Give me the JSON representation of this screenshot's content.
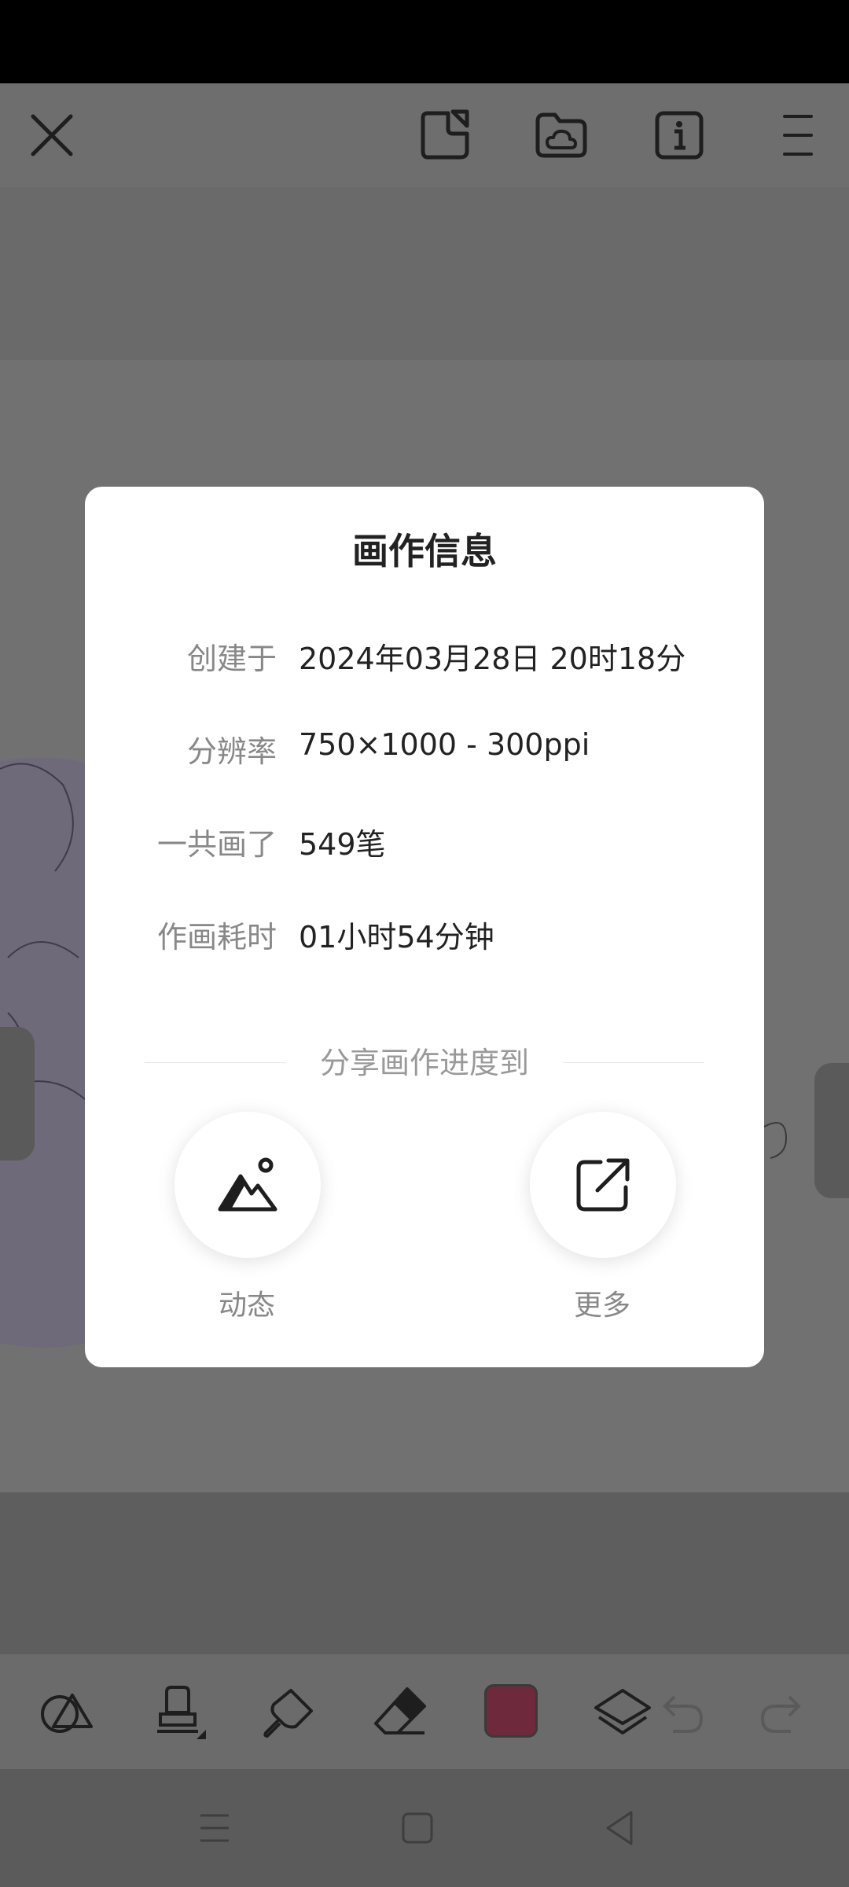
{
  "toolbar": {
    "icons": [
      "close-icon",
      "sticker-icon",
      "cloud-folder-icon",
      "info-icon",
      "menu-icon"
    ]
  },
  "dialog": {
    "title": "画作信息",
    "rows": [
      {
        "label": "创建于",
        "value": "2024年03月28日 20时18分"
      },
      {
        "label": "分辨率",
        "value": "750×1000 - 300ppi"
      },
      {
        "label": "一共画了",
        "value": "549笔"
      },
      {
        "label": "作画耗时",
        "value": "01小时54分钟"
      }
    ],
    "share_heading": "分享画作进度到",
    "share_moments_label": "动态",
    "share_more_label": "更多"
  },
  "bottom_toolbar": {
    "icons": [
      "shapes-icon",
      "stamp-icon",
      "brush-icon",
      "eraser-icon",
      "color-swatch",
      "layers-icon",
      "undo-icon",
      "redo-icon"
    ],
    "current_color": "#6e2a3c"
  },
  "nav": {
    "icons": [
      "recents-icon",
      "home-icon",
      "back-icon"
    ]
  }
}
